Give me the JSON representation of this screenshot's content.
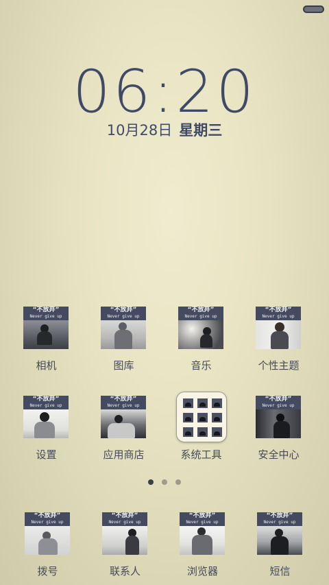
{
  "lock": {
    "time": "06:20",
    "date": "10月28日",
    "weekday": "星期三"
  },
  "icon_banner": {
    "title": "“不放弃”",
    "subtitle": "Never give up"
  },
  "apps": [
    {
      "label": "相机"
    },
    {
      "label": "图库"
    },
    {
      "label": "音乐"
    },
    {
      "label": "个性主题"
    },
    {
      "label": "设置"
    },
    {
      "label": "应用商店"
    },
    {
      "label": "系统工具"
    },
    {
      "label": "安全中心"
    }
  ],
  "dock": [
    {
      "label": "拨号"
    },
    {
      "label": "联系人"
    },
    {
      "label": "浏览器"
    },
    {
      "label": "短信"
    }
  ],
  "pager": {
    "pages": 3,
    "current": 1
  },
  "colors": {
    "accent": "#404a66",
    "banner": "#444a60"
  }
}
